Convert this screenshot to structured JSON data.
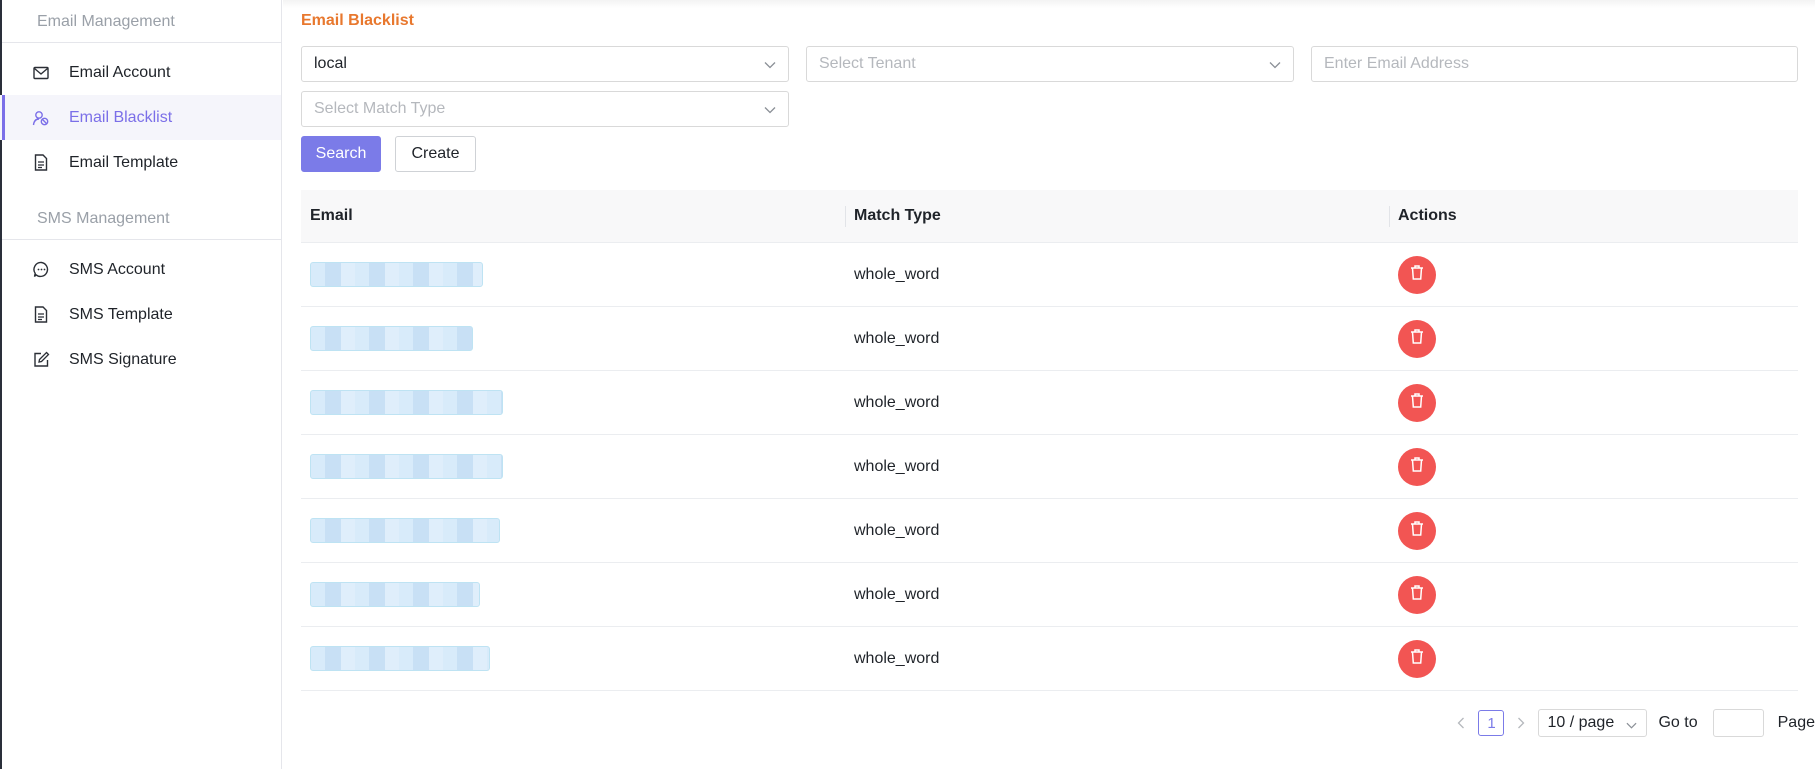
{
  "sidebar": {
    "groups": [
      {
        "title": "Email Management",
        "items": [
          {
            "label": "Email Account",
            "icon": "mail-icon"
          },
          {
            "label": "Email Blacklist",
            "icon": "user-block-icon",
            "active": true
          },
          {
            "label": "Email Template",
            "icon": "document-icon"
          }
        ]
      },
      {
        "title": "SMS Management",
        "items": [
          {
            "label": "SMS Account",
            "icon": "chat-bubble-icon"
          },
          {
            "label": "SMS Template",
            "icon": "document-icon"
          },
          {
            "label": "SMS Signature",
            "icon": "edit-icon"
          }
        ]
      }
    ]
  },
  "main": {
    "title": "Email Blacklist",
    "filters": {
      "environment_value": "local",
      "tenant_placeholder": "Select Tenant",
      "email_placeholder": "Enter Email Address",
      "match_type_placeholder": "Select Match Type"
    },
    "buttons": {
      "search": "Search",
      "create": "Create"
    },
    "table": {
      "columns": [
        "Email",
        "Match Type",
        "Actions"
      ],
      "rows": [
        {
          "email_redacted": true,
          "match_type": "whole_word"
        },
        {
          "email_redacted": true,
          "match_type": "whole_word"
        },
        {
          "email_redacted": true,
          "match_type": "whole_word"
        },
        {
          "email_redacted": true,
          "match_type": "whole_word"
        },
        {
          "email_redacted": true,
          "match_type": "whole_word"
        },
        {
          "email_redacted": true,
          "match_type": "whole_word"
        },
        {
          "email_redacted": true,
          "match_type": "whole_word"
        }
      ]
    },
    "pagination": {
      "current_page": "1",
      "page_size": "10 / page",
      "goto_label": "Go to",
      "page_label": "Page"
    }
  },
  "colors": {
    "accent": "#7b7be8",
    "title": "#e8782e",
    "danger": "#f25553"
  }
}
